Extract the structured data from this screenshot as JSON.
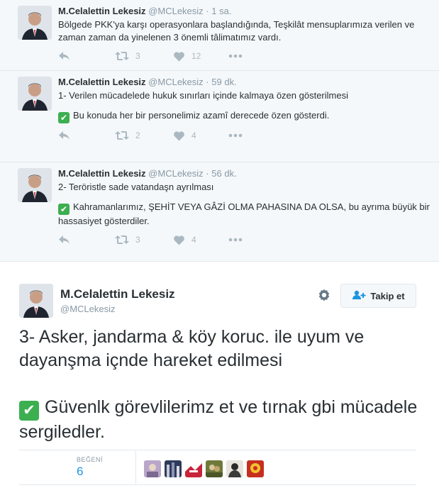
{
  "thread": [
    {
      "name": "M.Celalettin Lekesiz",
      "handle": "@MCLekesiz",
      "time": "1 sa.",
      "paragraphs": [
        "Bölgede PKK'ya karşı operasyonlara başlandığında, Teşkilât mensuplarımıza verilen ve zaman zaman da yinelenen 3 önemli tâlimatımız vardı."
      ],
      "retweets": "3",
      "likes": "12"
    },
    {
      "name": "M.Celalettin Lekesiz",
      "handle": "@MCLekesiz",
      "time": "59 dk.",
      "paragraphs": [
        "1- Verilen mücadelede hukuk sınırları içinde kalmaya özen gösterilmesi",
        "Bu konuda her bir personelimiz azamî derecede özen gösterdi."
      ],
      "retweets": "2",
      "likes": "4"
    },
    {
      "name": "M.Celalettin Lekesiz",
      "handle": "@MCLekesiz",
      "time": "56 dk.",
      "paragraphs": [
        "2- Teröristle sade vatandaşn ayrılması",
        "Kahramanlarımız, ŞEHİT VEYA GÂZİ OLMA PAHASINA DA OLSA, bu ayrıma büyük bir hassasiyet gösterdiler."
      ],
      "retweets": "3",
      "likes": "4"
    }
  ],
  "main_tweet": {
    "name": "M.Celalettin Lekesiz",
    "handle": "@MCLekesiz",
    "follow_label": "Takip et",
    "paragraph_1": "3- Asker, jandarma & köy koruc. ile uyum ve dayanşma içnde hareket edilmesi",
    "paragraph_2": "Güvenlk görevlilerimz et ve tırnak gbi mücadele sergiledler.",
    "likes_label": "BEĞENİ",
    "likes_count": "6"
  },
  "icons": {
    "reply": "reply-icon",
    "retweet": "retweet-icon",
    "like": "heart-icon",
    "more": "more-icon",
    "check": "check-mark-icon",
    "settings": "gear-icon",
    "follow": "add-user-icon"
  },
  "colors": {
    "accent": "#1b95e0",
    "check": "#3caf50",
    "muted": "#8899a6",
    "icon": "#aab8c2"
  }
}
